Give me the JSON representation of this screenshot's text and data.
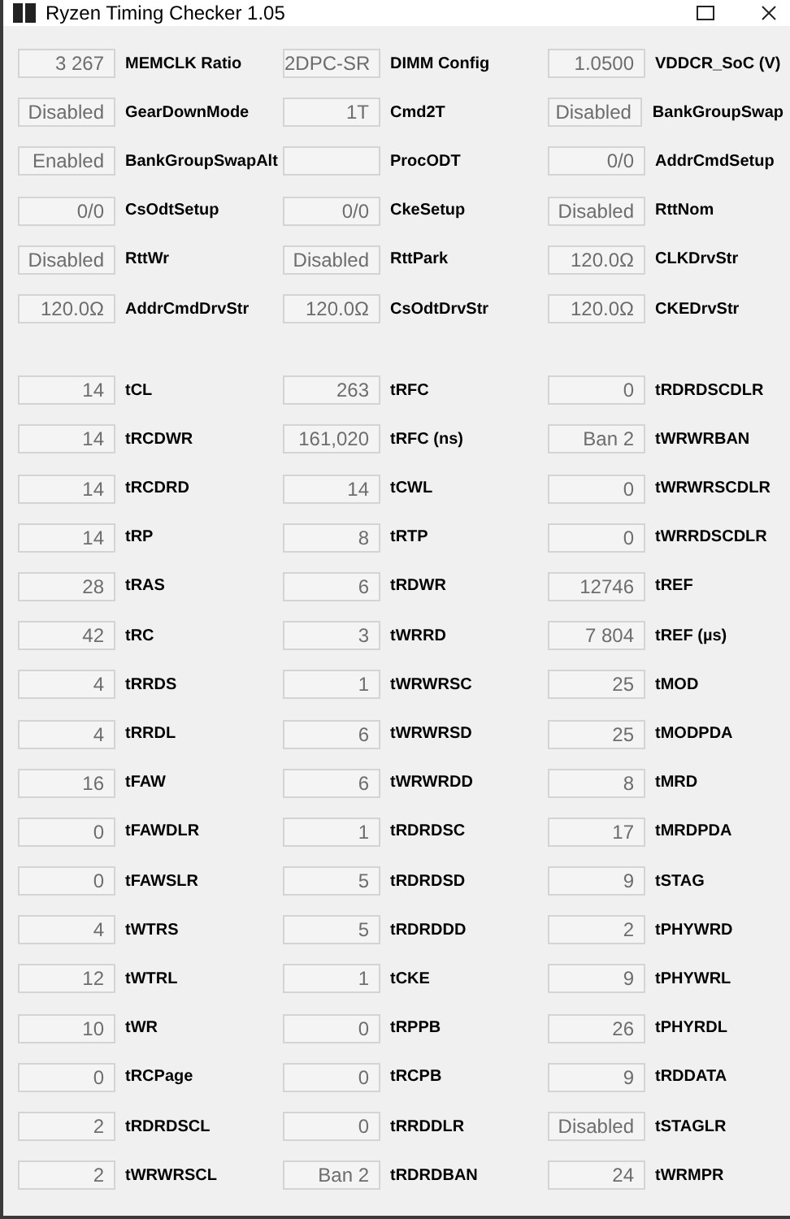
{
  "window": {
    "title": "Ryzen Timing Checker 1.05"
  },
  "sections": [
    {
      "fields": [
        {
          "value": "3 267",
          "label": "MEMCLK Ratio"
        },
        {
          "value": "2DPC-SR",
          "label": "DIMM Config"
        },
        {
          "value": "1.0500",
          "label": "VDDCR_SoC (V)"
        },
        {
          "value": "Disabled",
          "label": "GearDownMode"
        },
        {
          "value": "1T",
          "label": "Cmd2T"
        },
        {
          "value": "Disabled",
          "label": "BankGroupSwap"
        },
        {
          "value": "Enabled",
          "label": "BankGroupSwapAlt"
        },
        {
          "label": "ProcODT"
        },
        {
          "value": "0/0",
          "label": "AddrCmdSetup"
        },
        {
          "value": "0/0",
          "label": "CsOdtSetup"
        },
        {
          "value": "0/0",
          "label": "CkeSetup"
        },
        {
          "value": "Disabled",
          "label": "RttNom"
        },
        {
          "value": "Disabled",
          "label": "RttWr"
        },
        {
          "value": "Disabled",
          "label": "RttPark"
        },
        {
          "value": "120.0Ω",
          "label": "CLKDrvStr"
        },
        {
          "value": "120.0Ω",
          "label": "AddrCmdDrvStr"
        },
        {
          "value": "120.0Ω",
          "label": "CsOdtDrvStr"
        },
        {
          "value": "120.0Ω",
          "label": "CKEDrvStr"
        }
      ]
    },
    {
      "fields": [
        {
          "value": "14",
          "label": "tCL"
        },
        {
          "value": "263",
          "label": "tRFC"
        },
        {
          "value": "0",
          "label": "tRDRDSCDLR"
        },
        {
          "value": "14",
          "label": "tRCDWR"
        },
        {
          "value": "161,020",
          "label": "tRFC (ns)"
        },
        {
          "value": "Ban 2",
          "label": "tWRWRBAN"
        },
        {
          "value": "14",
          "label": "tRCDRD"
        },
        {
          "value": "14",
          "label": "tCWL"
        },
        {
          "value": "0",
          "label": "tWRWRSCDLR"
        },
        {
          "value": "14",
          "label": "tRP"
        },
        {
          "value": "8",
          "label": "tRTP"
        },
        {
          "value": "0",
          "label": "tWRRDSCDLR"
        },
        {
          "value": "28",
          "label": "tRAS"
        },
        {
          "value": "6",
          "label": "tRDWR"
        },
        {
          "value": "12746",
          "label": "tREF"
        },
        {
          "value": "42",
          "label": "tRC"
        },
        {
          "value": "3",
          "label": "tWRRD"
        },
        {
          "value": "7 804",
          "label": "tREF (µs)"
        },
        {
          "value": "4",
          "label": "tRRDS"
        },
        {
          "value": "1",
          "label": "tWRWRSC"
        },
        {
          "value": "25",
          "label": "tMOD"
        },
        {
          "value": "4",
          "label": "tRRDL"
        },
        {
          "value": "6",
          "label": "tWRWRSD"
        },
        {
          "value": "25",
          "label": "tMODPDA"
        },
        {
          "value": "16",
          "label": "tFAW"
        },
        {
          "value": "6",
          "label": "tWRWRDD"
        },
        {
          "value": "8",
          "label": "tMRD"
        },
        {
          "value": "0",
          "label": "tFAWDLR"
        },
        {
          "value": "1",
          "label": "tRDRDSC"
        },
        {
          "value": "17",
          "label": "tMRDPDA"
        },
        {
          "value": "0",
          "label": "tFAWSLR"
        },
        {
          "value": "5",
          "label": "tRDRDSD"
        },
        {
          "value": "9",
          "label": "tSTAG"
        },
        {
          "value": "4",
          "label": "tWTRS"
        },
        {
          "value": "5",
          "label": "tRDRDDD"
        },
        {
          "value": "2",
          "label": "tPHYWRD"
        },
        {
          "value": "12",
          "label": "tWTRL"
        },
        {
          "value": "1",
          "label": "tCKE"
        },
        {
          "value": "9",
          "label": "tPHYWRL"
        },
        {
          "value": "10",
          "label": "tWR"
        },
        {
          "value": "0",
          "label": "tRPPB"
        },
        {
          "value": "26",
          "label": "tPHYRDL"
        },
        {
          "value": "0",
          "label": "tRCPage"
        },
        {
          "value": "0",
          "label": "tRCPB"
        },
        {
          "value": "9",
          "label": "tRDDATA"
        },
        {
          "value": "2",
          "label": "tRDRDSCL"
        },
        {
          "value": "0",
          "label": "tRRDDLR"
        },
        {
          "value": "Disabled",
          "label": "tSTAGLR"
        },
        {
          "value": "2",
          "label": "tWRWRSCL"
        },
        {
          "value": "Ban 2",
          "label": "tRDRDBAN"
        },
        {
          "value": "24",
          "label": "tWRMPR"
        }
      ]
    }
  ]
}
